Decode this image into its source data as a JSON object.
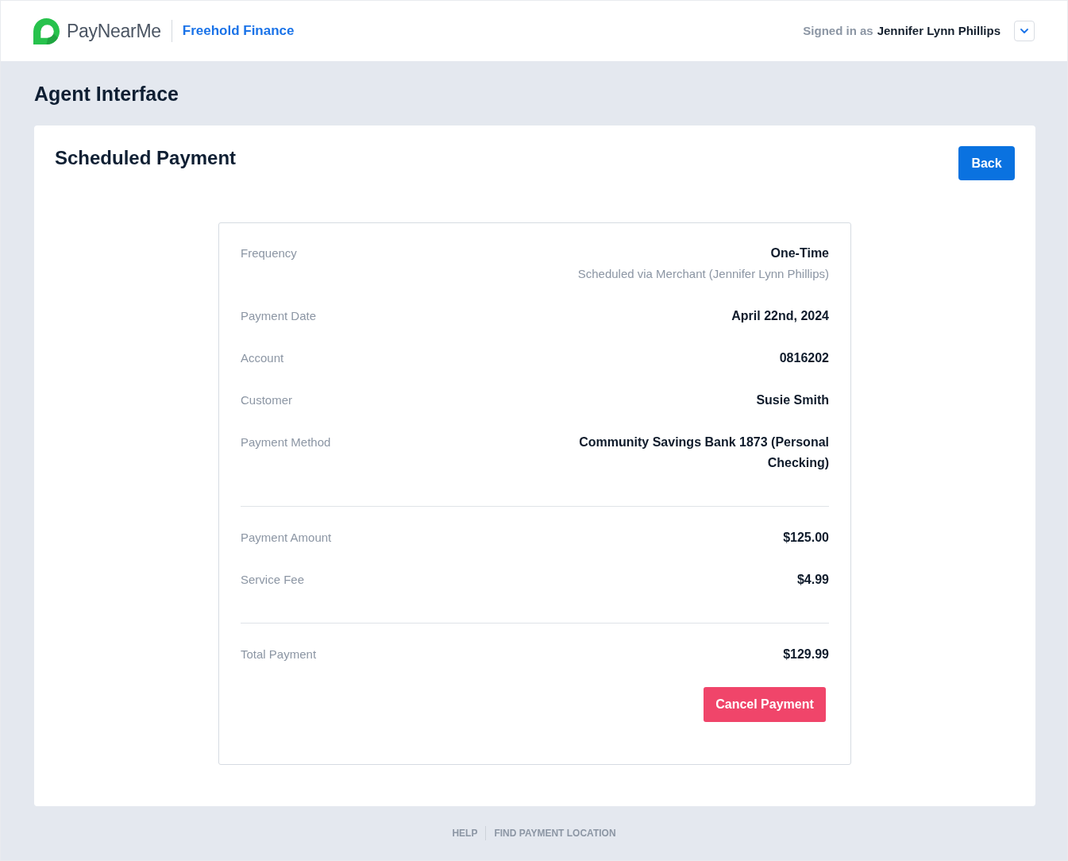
{
  "header": {
    "logo": {
      "name": "PayNearMe"
    },
    "merchant": "Freehold Finance",
    "signed_in": {
      "label": "Signed in as",
      "user": "Jennifer Lynn Phillips"
    }
  },
  "page_title": "Agent Interface",
  "card": {
    "title": "Scheduled Payment",
    "back_button": "Back",
    "sections": [
      {
        "rows": [
          {
            "label": "Frequency",
            "value": "One-Time",
            "note": "Scheduled via Merchant (Jennifer Lynn Phillips)"
          },
          {
            "label": "Payment Date",
            "value": "April 22nd, 2024"
          },
          {
            "label": "Account",
            "value": "0816202"
          },
          {
            "label": "Customer",
            "value": "Susie Smith"
          },
          {
            "label": "Payment Method",
            "value": "Community Savings Bank 1873 (Personal Checking)"
          }
        ]
      },
      {
        "rows": [
          {
            "label": "Payment Amount",
            "value": "$125.00"
          },
          {
            "label": "Service Fee",
            "value": "$4.99"
          }
        ]
      },
      {
        "rows": [
          {
            "label": "Total Payment",
            "value": "$129.99"
          }
        ]
      }
    ],
    "cancel_button": "Cancel Payment"
  },
  "footer": {
    "links": [
      "HELP",
      "FIND PAYMENT LOCATION"
    ]
  }
}
